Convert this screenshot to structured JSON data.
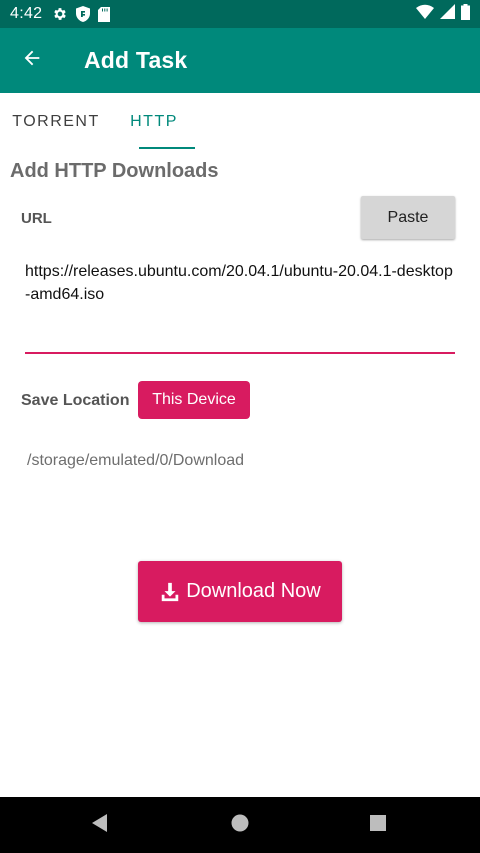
{
  "status_bar": {
    "time": "4:42",
    "icons_left": [
      "gear-icon",
      "shield-icon",
      "sd-card-icon"
    ],
    "icons_right": [
      "wifi-icon",
      "signal-icon",
      "battery-icon"
    ]
  },
  "app_bar": {
    "title": "Add Task",
    "back_icon": "arrow-back-icon"
  },
  "tabs": [
    {
      "label": "TORRENT",
      "selected": false
    },
    {
      "label": "HTTP",
      "selected": true
    }
  ],
  "form": {
    "section_title": "Add HTTP Downloads",
    "url_label": "URL",
    "paste_label": "Paste",
    "url_value": "https://releases.ubuntu.com/20.04.1/ubuntu-20.04.1-desktop-amd64.iso",
    "save_location_label": "Save Location",
    "device_button_label": "This Device",
    "save_path": "/storage/emulated/0/Download",
    "download_button_label": "Download Now"
  },
  "nav_bar": {
    "buttons": [
      "back-triangle-icon",
      "home-circle-icon",
      "recents-square-icon"
    ]
  },
  "colors": {
    "status_bar": "#00695c",
    "app_bar": "#00897b",
    "accent": "#d81b60",
    "tab_selected": "#00897b"
  }
}
